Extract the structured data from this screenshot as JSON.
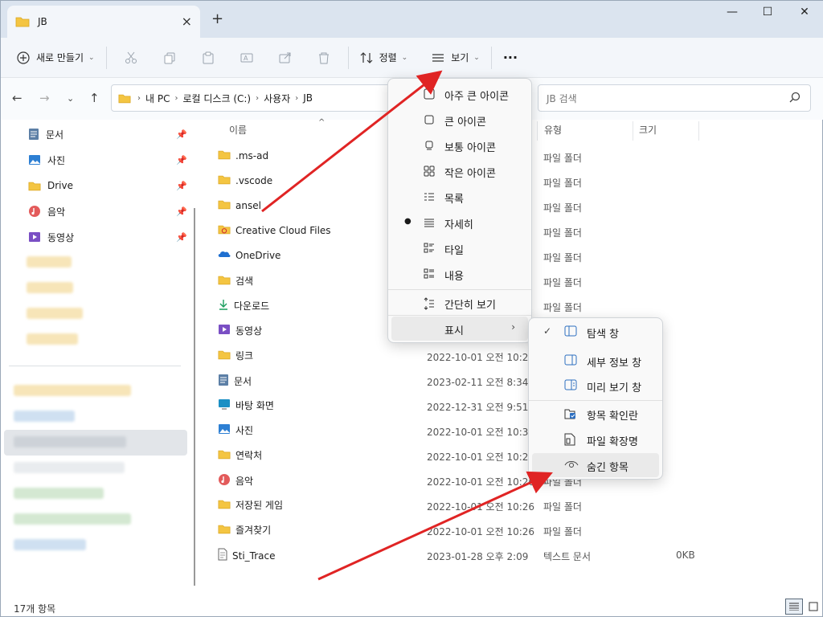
{
  "window": {
    "tab_title": "JB",
    "tab_close": "×",
    "new_tab": "+",
    "minimize": "—",
    "maximize": "☐",
    "close": "✕"
  },
  "toolbar": {
    "new_label": "새로 만들기",
    "sort_label": "정렬",
    "view_label": "보기",
    "more_label": "···"
  },
  "address": {
    "crumbs": [
      "내 PC",
      "로컬 디스크 (C:)",
      "사용자",
      "JB"
    ],
    "search_placeholder": "JB 검색"
  },
  "sidebar": {
    "pinned": [
      {
        "label": "문서",
        "icon": "document-icon"
      },
      {
        "label": "사진",
        "icon": "pictures-icon"
      },
      {
        "label": "Drive",
        "icon": "folder-icon"
      },
      {
        "label": "음악",
        "icon": "music-icon"
      },
      {
        "label": "동영상",
        "icon": "video-icon"
      }
    ]
  },
  "columns": {
    "name": "이름",
    "type": "유형",
    "size": "크기"
  },
  "files": [
    {
      "name": ".ms-ad",
      "date": "",
      "type": "파일 폴더",
      "size": "",
      "icon": "folder-icon"
    },
    {
      "name": ".vscode",
      "date": "",
      "type": "파일 폴더",
      "size": "",
      "icon": "folder-icon"
    },
    {
      "name": "ansel",
      "date": "",
      "type": "파일 폴더",
      "size": "",
      "icon": "folder-icon"
    },
    {
      "name": "Creative Cloud Files",
      "date": "",
      "type": "파일 폴더",
      "size": "",
      "icon": "creative-cloud-folder-icon"
    },
    {
      "name": "OneDrive",
      "date": "",
      "type": "파일 폴더",
      "size": "",
      "icon": "onedrive-icon"
    },
    {
      "name": "검색",
      "date": "",
      "type": "파일 폴더",
      "size": "",
      "icon": "folder-icon"
    },
    {
      "name": "다운로드",
      "date": "",
      "type": "파일 폴더",
      "size": "",
      "icon": "download-icon"
    },
    {
      "name": "동영상",
      "date": "",
      "type": "",
      "size": "",
      "icon": "video-icon"
    },
    {
      "name": "링크",
      "date": "2022-10-01 오전 10:26",
      "type": "",
      "size": "",
      "icon": "folder-icon"
    },
    {
      "name": "문서",
      "date": "2023-02-11 오전 8:34",
      "type": "",
      "size": "",
      "icon": "document-icon"
    },
    {
      "name": "바탕 화면",
      "date": "2022-12-31 오전 9:51",
      "type": "",
      "size": "",
      "icon": "desktop-icon"
    },
    {
      "name": "사진",
      "date": "2022-10-01 오전 10:32",
      "type": "",
      "size": "",
      "icon": "pictures-icon"
    },
    {
      "name": "연락처",
      "date": "2022-10-01 오전 10:26",
      "type": "",
      "size": "",
      "icon": "folder-icon"
    },
    {
      "name": "음악",
      "date": "2022-10-01 오전 10:26",
      "type": "파일 폴더",
      "size": "",
      "icon": "music-icon"
    },
    {
      "name": "저장된 게임",
      "date": "2022-10-01 오전 10:26",
      "type": "파일 폴더",
      "size": "",
      "icon": "folder-icon"
    },
    {
      "name": "즐겨찾기",
      "date": "2022-10-01 오전 10:26",
      "type": "파일 폴더",
      "size": "",
      "icon": "folder-icon"
    },
    {
      "name": "Sti_Trace",
      "date": "2023-01-28 오후 2:09",
      "type": "텍스트 문서",
      "size": "0KB",
      "icon": "text-file-icon"
    }
  ],
  "status": {
    "count": "17개 항목"
  },
  "view_menu": {
    "items": [
      {
        "label": "아주 큰 아이콘",
        "icon": "extra-large-icons-icon",
        "selected": false
      },
      {
        "label": "큰 아이콘",
        "icon": "large-icons-icon",
        "selected": false
      },
      {
        "label": "보통 아이콘",
        "icon": "medium-icons-icon",
        "selected": false
      },
      {
        "label": "작은 아이콘",
        "icon": "small-icons-icon",
        "selected": false
      },
      {
        "label": "목록",
        "icon": "list-icon",
        "selected": false
      },
      {
        "label": "자세히",
        "icon": "details-icon",
        "selected": true
      },
      {
        "label": "타일",
        "icon": "tiles-icon",
        "selected": false
      },
      {
        "label": "내용",
        "icon": "content-icon",
        "selected": false
      }
    ],
    "compact_label": "간단히 보기",
    "show_label": "표시"
  },
  "show_submenu": {
    "items": [
      {
        "label": "탐색 창",
        "icon": "navigation-pane-icon",
        "checked": true
      },
      {
        "label": "세부 정보 창",
        "icon": "details-pane-icon",
        "checked": false
      },
      {
        "label": "미리 보기 창",
        "icon": "preview-pane-icon",
        "checked": false
      },
      {
        "label": "항목 확인란",
        "icon": "item-checkbox-icon",
        "checked": false
      },
      {
        "label": "파일 확장명",
        "icon": "file-extension-icon",
        "checked": false
      },
      {
        "label": "숨긴 항목",
        "icon": "hidden-items-eye-icon",
        "checked": false
      }
    ]
  },
  "colors": {
    "accent": "#e02424",
    "folder": "#f4c542",
    "selection": "#e2e5e9"
  }
}
